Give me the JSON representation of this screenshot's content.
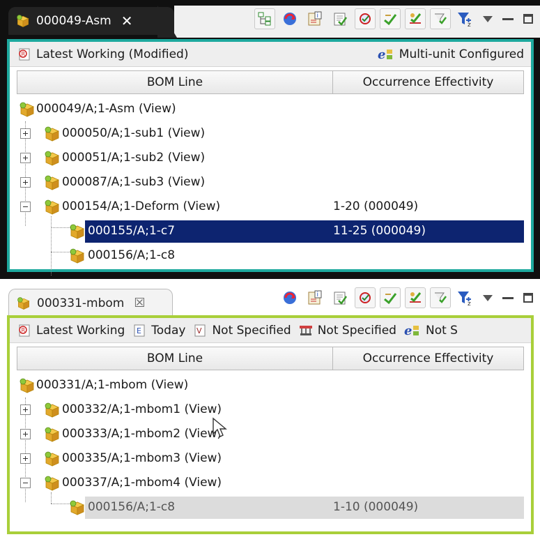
{
  "panel1": {
    "tab": {
      "title": "000049-Asm",
      "close": "✕",
      "icon": "assembly-icon"
    },
    "toolbar_icons": [
      "structure-icon",
      "transfer-icon",
      "info-icon",
      "checkout-icon",
      "revise-icon",
      "approve-icon",
      "sign-icon",
      "filter-check-icon",
      "funnel-icon"
    ],
    "infobar": {
      "revision_rule": "Latest Working (Modified)",
      "config": "Multi-unit Configured"
    },
    "columns": {
      "bom_line": "BOM Line",
      "effectivity": "Occurrence Effectivity"
    },
    "rows": [
      {
        "label": "000049/A;1-Asm (View)",
        "effectivity": ""
      },
      {
        "label": "000050/A;1-sub1 (View)",
        "effectivity": ""
      },
      {
        "label": "000051/A;1-sub2 (View)",
        "effectivity": ""
      },
      {
        "label": "000087/A;1-sub3 (View)",
        "effectivity": ""
      },
      {
        "label": "000154/A;1-Deform (View)",
        "effectivity": "1-20 (000049)"
      },
      {
        "label": "000155/A;1-c7",
        "effectivity": "11-25 (000049)"
      },
      {
        "label": "000156/A;1-c8",
        "effectivity": ""
      }
    ],
    "colors": {
      "frame": "#1ea99e",
      "selection": "#0d2470"
    }
  },
  "panel2": {
    "tab": {
      "title": "000331-mbom",
      "close": "☒",
      "icon": "assembly-icon"
    },
    "toolbar_icons": [
      "transfer-icon",
      "info-icon",
      "checkout-icon",
      "revise-icon",
      "approve-icon",
      "sign-icon",
      "filter-check-icon",
      "funnel-icon"
    ],
    "infobar": {
      "revision_rule": "Latest Working",
      "date": "Today",
      "variant": "Not Specified",
      "structure": "Not Specified",
      "config": "Not S"
    },
    "columns": {
      "bom_line": "BOM Line",
      "effectivity": "Occurrence Effectivity"
    },
    "rows": [
      {
        "label": "000331/A;1-mbom (View)",
        "effectivity": ""
      },
      {
        "label": "000332/A;1-mbom1 (View)",
        "effectivity": ""
      },
      {
        "label": "000333/A;1-mbom2 (View)",
        "effectivity": ""
      },
      {
        "label": "000335/A;1-mbom3 (View)",
        "effectivity": ""
      },
      {
        "label": "000337/A;1-mbom4 (View)",
        "effectivity": ""
      },
      {
        "label": "000156/A;1-c8",
        "effectivity": "1-10 (000049)"
      }
    ],
    "colors": {
      "frame": "#a9cf3a",
      "selection": "#dcdcdc"
    }
  }
}
